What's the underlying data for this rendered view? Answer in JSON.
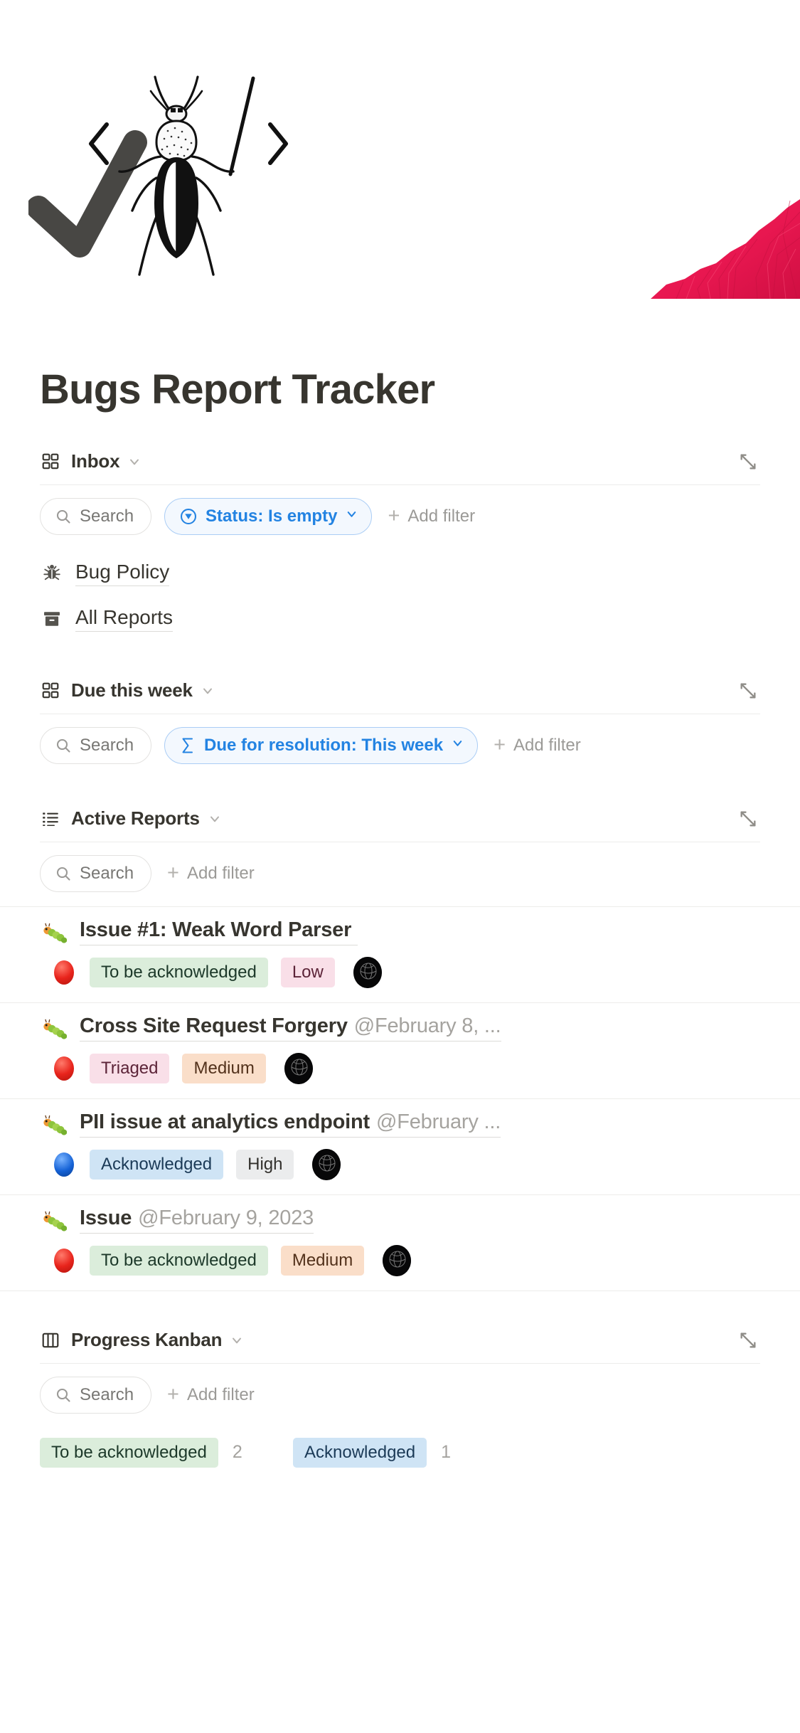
{
  "cover": {
    "alt_text": "beetle illustration with checkmark and angle brackets",
    "pink_color": "#ea1f55",
    "check_color": "#484744"
  },
  "page": {
    "title": "Bugs Report Tracker"
  },
  "common": {
    "search_label": "Search",
    "add_filter_label": "Add filter",
    "search_icon": "search-icon",
    "plus_icon": "plus-icon",
    "chevron_down_icon": "chevron-down-icon",
    "expand_icon": "expand-diagonal-icon"
  },
  "sections": [
    {
      "key": "inbox",
      "title": "Inbox",
      "icon": "grid-view-icon",
      "filters": [
        {
          "label": "Status: Is empty",
          "icon": "filter-circle-icon",
          "active": true
        }
      ]
    },
    {
      "key": "due_this_week",
      "title": "Due this week",
      "icon": "grid-view-icon",
      "filters": [
        {
          "label": "Due for resolution: This week",
          "icon": "sigma-icon",
          "active": true
        }
      ]
    },
    {
      "key": "active_reports",
      "title": "Active Reports",
      "icon": "list-view-icon",
      "filters": []
    },
    {
      "key": "progress_kanban",
      "title": "Progress Kanban",
      "icon": "board-view-icon",
      "filters": []
    }
  ],
  "links": [
    {
      "label": "Bug Policy",
      "icon": "bug-icon"
    },
    {
      "label": "All Reports",
      "icon": "archive-box-icon"
    }
  ],
  "reports": [
    {
      "emoji": "caterpillar-icon",
      "title": "Issue #1: Weak Word Parser",
      "subtitle": "",
      "dot": "red",
      "status": {
        "label": "To be acknowledged",
        "color": "green"
      },
      "priority": {
        "label": "Low",
        "color": "pink"
      },
      "avatar": "user-avatar"
    },
    {
      "emoji": "caterpillar-icon",
      "title": "Cross Site Request Forgery",
      "subtitle": "@February 8, ...",
      "dot": "red",
      "status": {
        "label": "Triaged",
        "color": "pink"
      },
      "priority": {
        "label": "Medium",
        "color": "orange"
      },
      "avatar": "user-avatar"
    },
    {
      "emoji": "caterpillar-icon",
      "title": "PII issue at analytics endpoint",
      "subtitle": "@February ...",
      "dot": "blue",
      "status": {
        "label": "Acknowledged",
        "color": "bluebg"
      },
      "priority": {
        "label": "High",
        "color": "gray"
      },
      "avatar": "user-avatar"
    },
    {
      "emoji": "caterpillar-icon",
      "title": "Issue",
      "subtitle": "@February 9, 2023",
      "dot": "red",
      "status": {
        "label": "To be acknowledged",
        "color": "green"
      },
      "priority": {
        "label": "Medium",
        "color": "orange"
      },
      "avatar": "user-avatar"
    }
  ],
  "kanban": {
    "columns": [
      {
        "label": "To be acknowledged",
        "color": "green",
        "count": "2"
      },
      {
        "label": "Acknowledged",
        "color": "bluebg",
        "count": "1"
      }
    ]
  }
}
